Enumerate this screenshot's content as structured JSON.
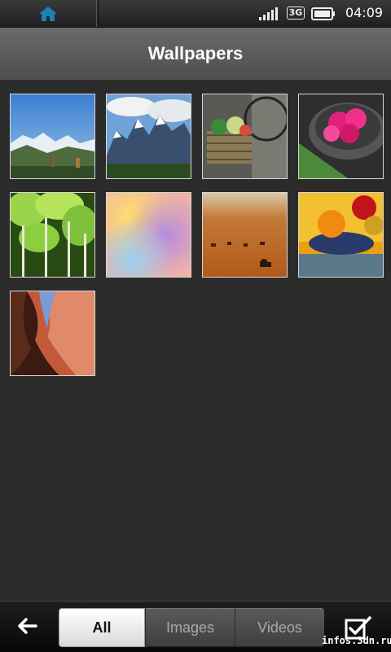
{
  "status_bar": {
    "time": "04:09",
    "network": "3G",
    "icons": [
      "home-icon",
      "signal-icon",
      "network-3g-icon",
      "battery-icon"
    ]
  },
  "header": {
    "title": "Wallpapers"
  },
  "wallpapers": [
    {
      "name": "wallpaper-mountain-valley"
    },
    {
      "name": "wallpaper-snowy-peaks"
    },
    {
      "name": "wallpaper-bicycle-basket"
    },
    {
      "name": "wallpaper-pink-flowers-bowl"
    },
    {
      "name": "wallpaper-green-trees"
    },
    {
      "name": "wallpaper-blurred-colors"
    },
    {
      "name": "wallpaper-desert-camels"
    },
    {
      "name": "wallpaper-fruit-bowl"
    },
    {
      "name": "wallpaper-canyon"
    }
  ],
  "toolbar": {
    "back_icon": "back-arrow-icon",
    "filters": [
      {
        "label": "All",
        "selected": true
      },
      {
        "label": "Images",
        "selected": false
      },
      {
        "label": "Videos",
        "selected": false
      }
    ],
    "select_icon": "checkbox-select-icon"
  },
  "watermark": "infos.3dn.ru",
  "colors": {
    "accent_home": "#1f7fb3",
    "title_bar": "#5c5c5c",
    "background": "#2b2b2b",
    "selected_segment": "#ffffff"
  }
}
